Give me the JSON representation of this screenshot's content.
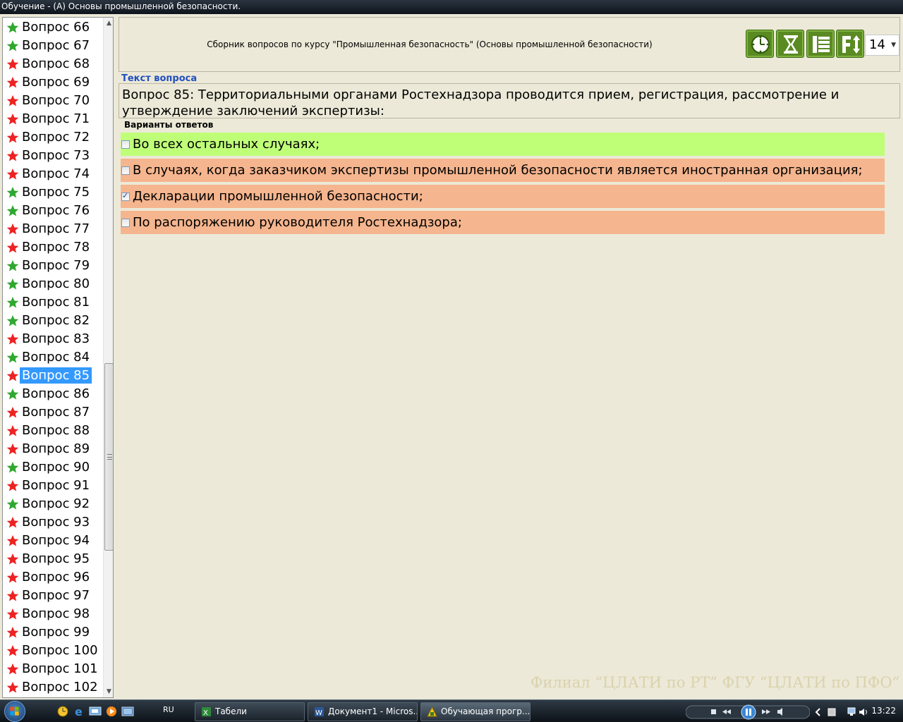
{
  "window": {
    "title": "Обучение - (А) Основы промышленной безопасности."
  },
  "header": {
    "title": "Сборник вопросов по курсу \"Промышленная безопасность\" (Основы промышленной безопасности)",
    "font_size_value": "14"
  },
  "questions": [
    {
      "label": "Вопрос 66",
      "status": "green"
    },
    {
      "label": "Вопрос 67",
      "status": "green"
    },
    {
      "label": "Вопрос 68",
      "status": "red"
    },
    {
      "label": "Вопрос 69",
      "status": "red"
    },
    {
      "label": "Вопрос 70",
      "status": "red"
    },
    {
      "label": "Вопрос 71",
      "status": "red"
    },
    {
      "label": "Вопрос 72",
      "status": "red"
    },
    {
      "label": "Вопрос 73",
      "status": "red"
    },
    {
      "label": "Вопрос 74",
      "status": "red"
    },
    {
      "label": "Вопрос 75",
      "status": "green"
    },
    {
      "label": "Вопрос 76",
      "status": "green"
    },
    {
      "label": "Вопрос 77",
      "status": "red"
    },
    {
      "label": "Вопрос 78",
      "status": "red"
    },
    {
      "label": "Вопрос 79",
      "status": "green"
    },
    {
      "label": "Вопрос 80",
      "status": "green"
    },
    {
      "label": "Вопрос 81",
      "status": "green"
    },
    {
      "label": "Вопрос 82",
      "status": "green"
    },
    {
      "label": "Вопрос 83",
      "status": "red"
    },
    {
      "label": "Вопрос 84",
      "status": "green"
    },
    {
      "label": "Вопрос 85",
      "status": "red",
      "selected": true
    },
    {
      "label": "Вопрос 86",
      "status": "green"
    },
    {
      "label": "Вопрос 87",
      "status": "red"
    },
    {
      "label": "Вопрос 88",
      "status": "red"
    },
    {
      "label": "Вопрос 89",
      "status": "red"
    },
    {
      "label": "Вопрос 90",
      "status": "green"
    },
    {
      "label": "Вопрос 91",
      "status": "red"
    },
    {
      "label": "Вопрос 92",
      "status": "green"
    },
    {
      "label": "Вопрос 93",
      "status": "red"
    },
    {
      "label": "Вопрос 94",
      "status": "red"
    },
    {
      "label": "Вопрос 95",
      "status": "red"
    },
    {
      "label": "Вопрос 96",
      "status": "red"
    },
    {
      "label": "Вопрос 97",
      "status": "red"
    },
    {
      "label": "Вопрос 98",
      "status": "red"
    },
    {
      "label": "Вопрос 99",
      "status": "red"
    },
    {
      "label": "Вопрос 100",
      "status": "red"
    },
    {
      "label": "Вопрос 101",
      "status": "red"
    },
    {
      "label": "Вопрос 102",
      "status": "red"
    }
  ],
  "question": {
    "section_label": "Текст вопроса",
    "text": "Вопрос 85: Территориальными органами Ростехнадзора проводится прием, регистрация, рассмотрение и утверждение заключений экспертизы:"
  },
  "answers": {
    "section_label": "Варианты ответов",
    "items": [
      {
        "text": "Во всех остальных случаях;",
        "checked": false,
        "state": "correct"
      },
      {
        "text": "В случаях, когда заказчиком экспертизы промышленной безопасности является иностранная организация;",
        "checked": false,
        "state": "wrong"
      },
      {
        "text": "Декларации промышленной безопасности;",
        "checked": true,
        "state": "wrong"
      },
      {
        "text": "По распоряжению руководителя Ростехнадзора;",
        "checked": false,
        "state": "wrong"
      }
    ]
  },
  "watermark": "Филиал “ЦЛАТИ по РТ” ФГУ “ЦЛАТИ по ПФО”",
  "colors": {
    "star_green": "#2fa82f",
    "star_red": "#ee2222",
    "answer_correct": "#bfff78",
    "answer_wrong": "#f5b58e",
    "toolbar_green": "#5a8a22"
  },
  "taskbar": {
    "language": "RU",
    "tasks": [
      {
        "label": "Табели",
        "active": false
      },
      {
        "label": "Документ1 - Micros...",
        "active": false
      },
      {
        "label": "Обучающая прогр...",
        "active": true
      }
    ],
    "clock": "13:22"
  }
}
